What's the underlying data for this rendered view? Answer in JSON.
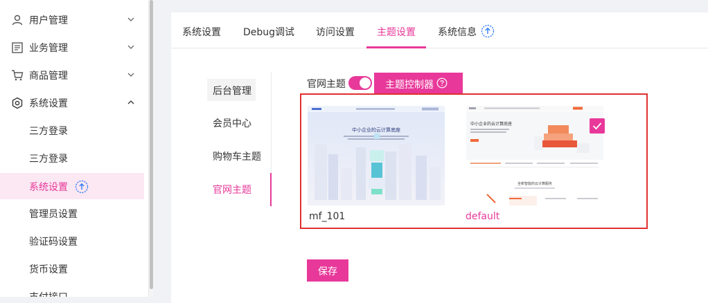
{
  "sidebar": {
    "menus": [
      {
        "label": "用户管理",
        "icon": "user-icon",
        "expanded": false
      },
      {
        "label": "业务管理",
        "icon": "document-list-icon",
        "expanded": false
      },
      {
        "label": "商品管理",
        "icon": "cart-icon",
        "expanded": false
      },
      {
        "label": "系统设置",
        "icon": "gear-icon",
        "expanded": true
      }
    ],
    "sub_items": [
      {
        "label": "三方登录"
      },
      {
        "label": "三方登录"
      },
      {
        "label": "系统设置",
        "active": true
      },
      {
        "label": "管理员设置"
      },
      {
        "label": "验证码设置"
      },
      {
        "label": "货币设置"
      },
      {
        "label": "支付接口"
      }
    ]
  },
  "tabs": [
    {
      "label": "系统设置"
    },
    {
      "label": "Debug调试"
    },
    {
      "label": "访问设置"
    },
    {
      "label": "主题设置",
      "active": true
    },
    {
      "label": "系统信息"
    }
  ],
  "vertical_tabs": [
    {
      "label": "后台管理"
    },
    {
      "label": "会员中心"
    },
    {
      "label": "购物车主题"
    },
    {
      "label": "官网主题",
      "active": true
    }
  ],
  "theme": {
    "label": "官网主题",
    "toggle_on": true,
    "controller_button": "主题控制器",
    "cards": [
      {
        "name": "mf_101",
        "selected": false
      },
      {
        "name": "default",
        "selected": true
      }
    ],
    "card1_headline": "中小企业的云计算底座",
    "card2_headline": "中小企业的云计算底座",
    "card2_subhead": "全新智能的云计算服务"
  },
  "save_label": "保存",
  "colors": {
    "accent": "#e8399a",
    "highlight_border": "#e0302f"
  }
}
